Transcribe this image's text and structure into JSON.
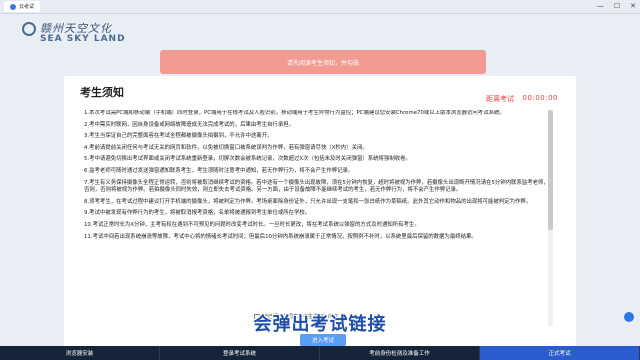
{
  "browser": {
    "tab_title": "云考试",
    "window_controls": [
      "—",
      "☐",
      "✕"
    ]
  },
  "logo": {
    "brand_cn": "赣州天空文化",
    "brand_en": "SEA SKY LAND"
  },
  "alert": {
    "text": "请先阅读考生须知，并勾选"
  },
  "notice": {
    "title": "考生须知",
    "timer_label": "距离考试",
    "timer_value": "00:00:00",
    "rules": [
      "1.本次考试需PC端和移动端（手机端）同时登录，PC端用于在线考试及人脸识别，移动端用于考生异常行为监控；PC端建议您安装Chrome70或以上版本浏览器访问考试系统。",
      "2.考中需实时联网，因自身设备或网络故障造成无法完成考试的，后果由考生自行承担。",
      "3.考生当保证自己的完整面容在考试全程都被摄像头拍摄到，不允许中途离开。",
      "4.考前请提前关闭任何与考试无关的网页和软件，以免被切换窗口被系统误判为作弊，若有弹窗请尽快（X秒内）关闭。",
      "5.考中请避免切换出考试界面或关闭考试系统重新登录，切屏次数会被系统记录，次数超过X次（包括末及时关闭弹窗）系统将强制收卷。",
      "6.监考老师可随时通过发送弹窗通知联系考生，考生须随时注意考中通知，若无作弊行为，将不会产生作弊记录。",
      "7.考生有义务保持摄像头全程正常运转，否则将被取消继续考试的资格。若中途有一个摄像头出现故障，须在5分钟内恢复，超时将被视为作弊，若摄像头出现断开情况请在5分钟内联系监考老师，否则，否则将被视为作弊。若拍摄像头同时失效，则立即失去考试资格。另一方面，由于设备故障不能继续考试的考生，若无作弊行为，将不会产生作弊记录。",
      "8.须考考生，在考试过程中建议打开手机端的摄像头，将被判定为作弊。考场桌面除身份证外，只允许出现一支笔和一张白纸作为草稿纸。此外其它动作和物品的出现将可能被判定为作弊。",
      "9.考试中被发现有作弊行为的考生，将被取消报考资格，名单将被通报到考生单位或所在学校。",
      "10.考试正常时长为X分钟，主考有权在遇到不可预见的问题时改变考试时长。一旦时长更改，将在考试系统以弹窗的方式及时通知所有考生。",
      "11.考试中间若出现系统崩溃等故障，考试中心将的情绪长考试时间；但最后10分钟内系统崩溃属于正常情况，按照例不补时，以系统里最后保留的数据为最终结果。"
    ],
    "agree_label": "我已阅读并同意《考生须知》内容",
    "enter_button": "进入考试"
  },
  "caption": "会弹出考试链接",
  "steps": [
    {
      "label": "浏览器安装",
      "active": false
    },
    {
      "label": "登录考试系统",
      "active": false
    },
    {
      "label": "考前身份检测及准备工作",
      "active": false
    },
    {
      "label": "正式考试",
      "active": true
    }
  ]
}
